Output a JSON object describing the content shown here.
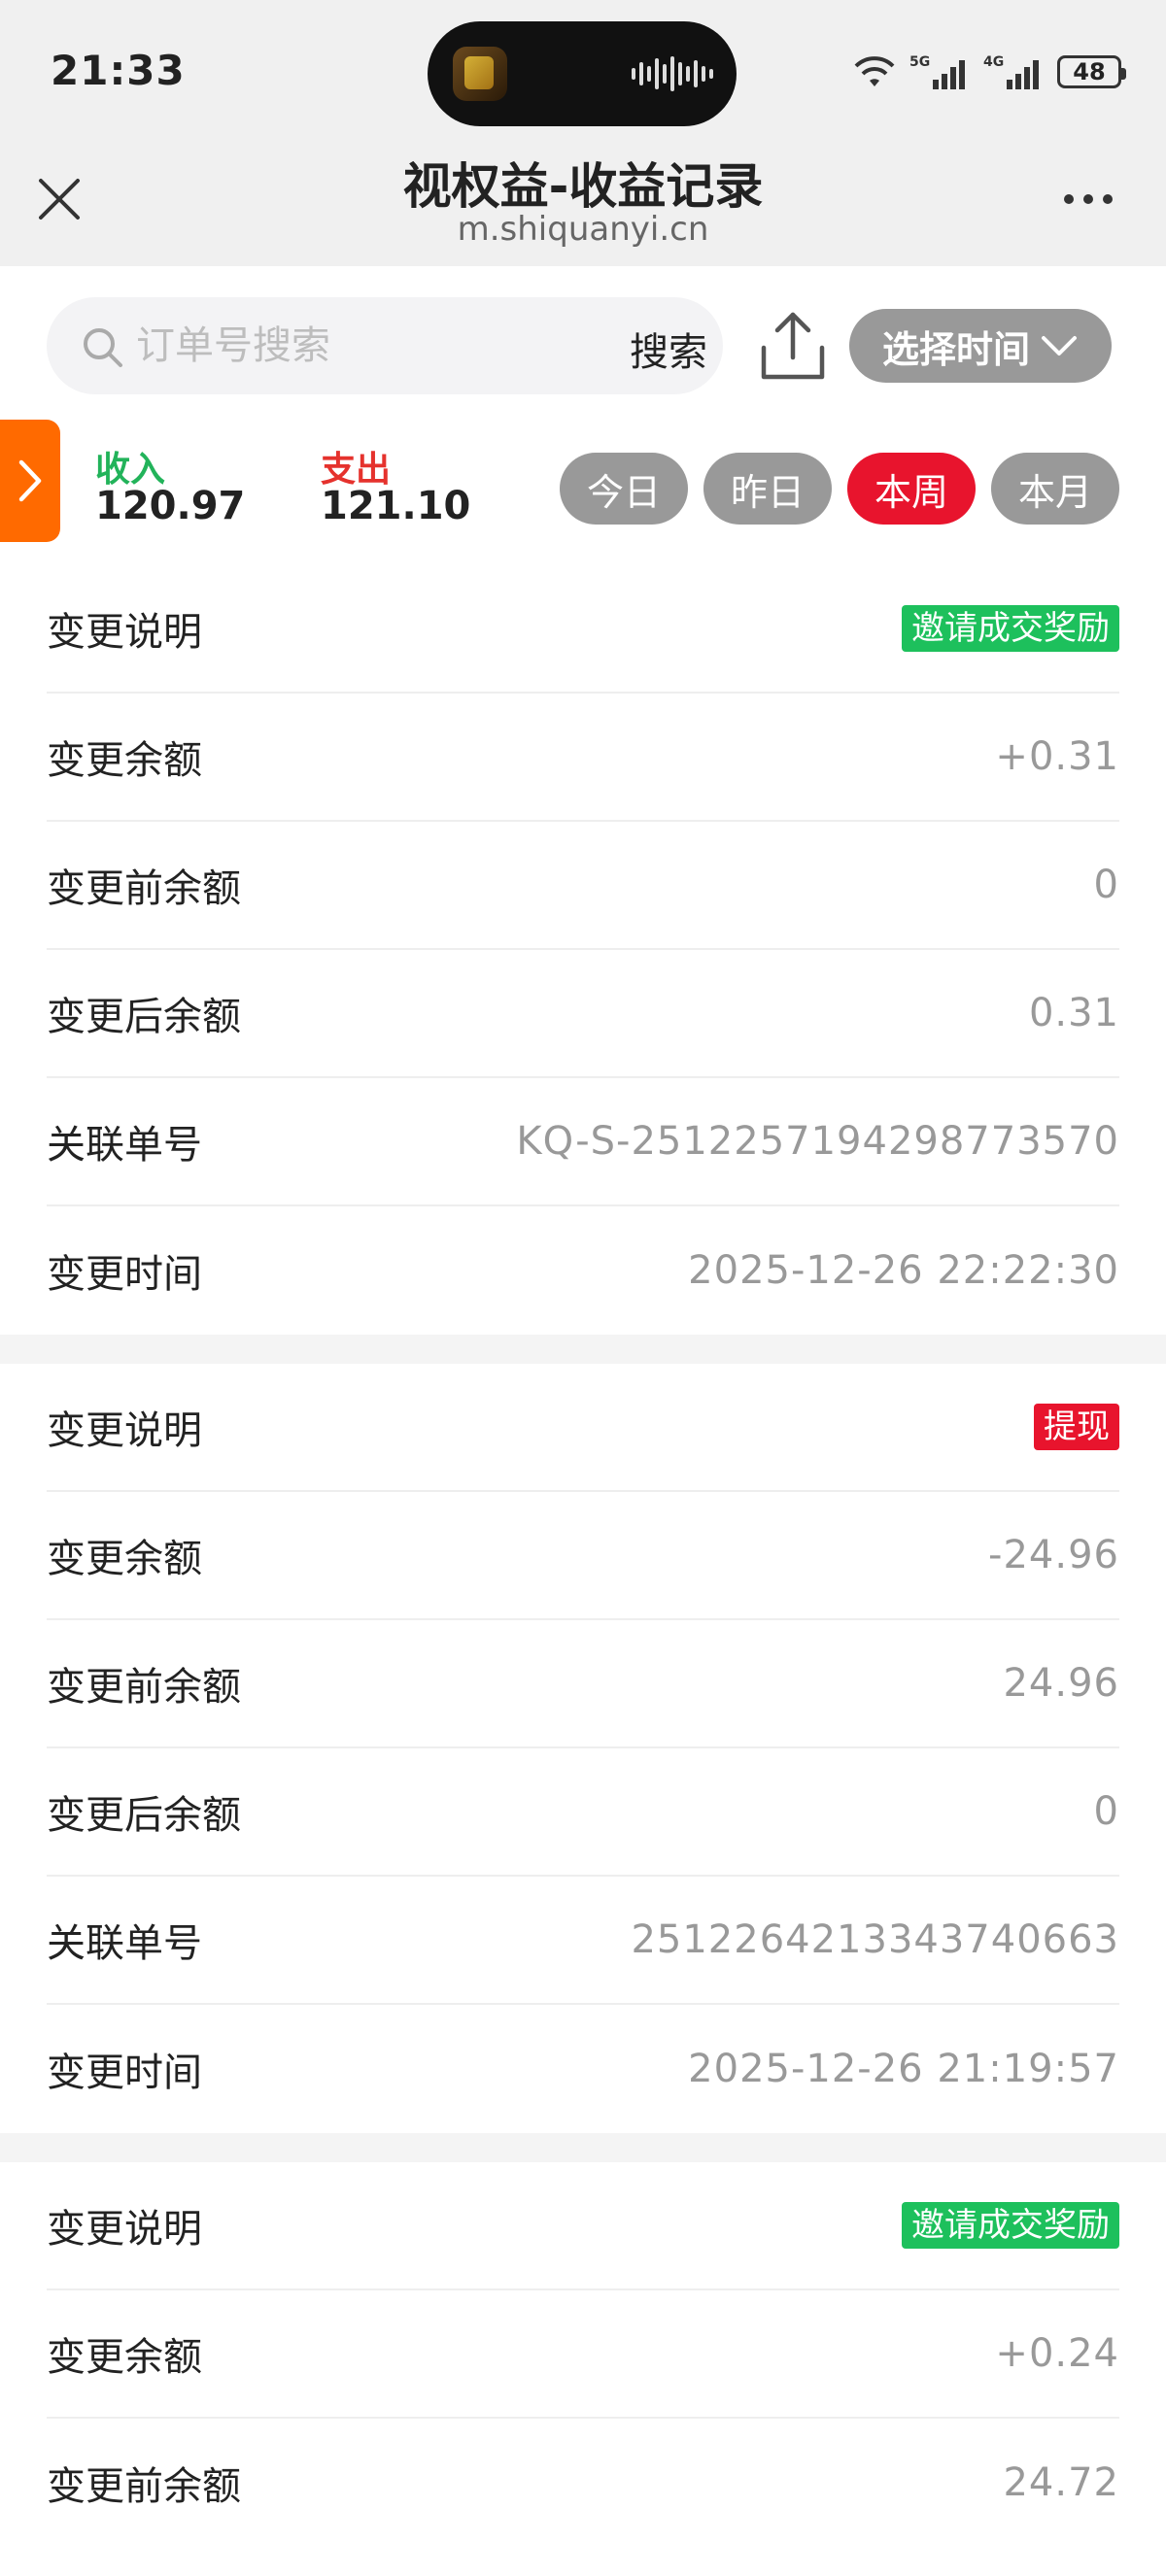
{
  "status_bar": {
    "time": "21:33",
    "battery": "48",
    "network_labels": [
      "5G",
      "4G"
    ],
    "icons": [
      "wifi-icon",
      "signal-icon",
      "signal-icon",
      "battery-icon"
    ]
  },
  "navbar": {
    "title": "视权益-收益记录",
    "subtitle": "m.shiquanyi.cn",
    "close_icon": "close-icon",
    "more_icon": "more-icon"
  },
  "search": {
    "placeholder": "订单号搜索",
    "button_label": "搜索",
    "upload_icon": "upload-icon",
    "time_select_label": "选择时间"
  },
  "summary": {
    "income_label": "收入",
    "income_value": "120.97",
    "expense_label": "支出",
    "expense_value": "121.10",
    "income_color": "#22b35a",
    "expense_color": "#e5322d"
  },
  "period_tabs": [
    {
      "label": "今日",
      "active": false
    },
    {
      "label": "昨日",
      "active": false
    },
    {
      "label": "本周",
      "active": true
    },
    {
      "label": "本月",
      "active": false
    }
  ],
  "colors": {
    "accent_red": "#e8142d",
    "tag_green": "#1dc05c",
    "side_tab_orange": "#ff6a00",
    "grey_pill": "#999999"
  },
  "records": [
    {
      "description_label": "变更说明",
      "tag": "邀请成交奖励",
      "tag_color": "green",
      "amount_label": "变更余额",
      "amount": "+0.31",
      "before_label": "变更前余额",
      "before": "0",
      "after_label": "变更后余额",
      "after": "0.31",
      "order_label": "关联单号",
      "order": "KQ-S-2512257194298773570",
      "time_label": "变更时间",
      "time": "2025-12-26 22:22:30"
    },
    {
      "description_label": "变更说明",
      "tag": "提现",
      "tag_color": "red",
      "amount_label": "变更余额",
      "amount": "-24.96",
      "before_label": "变更前余额",
      "before": "24.96",
      "after_label": "变更后余额",
      "after": "0",
      "order_label": "关联单号",
      "order": "2512264213343740663",
      "time_label": "变更时间",
      "time": "2025-12-26 21:19:57"
    },
    {
      "description_label": "变更说明",
      "tag": "邀请成交奖励",
      "tag_color": "green",
      "amount_label": "变更余额",
      "amount": "+0.24",
      "before_label": "变更前余额",
      "before": "24.72"
    }
  ]
}
